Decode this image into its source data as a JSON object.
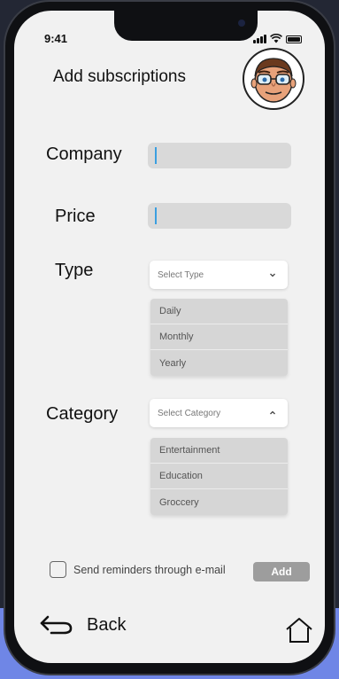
{
  "status_bar": {
    "time": "9:41"
  },
  "header": {
    "title": "Add subscriptions",
    "avatar_icon": "cartoon-face-avatar"
  },
  "form": {
    "company": {
      "label": "Company",
      "value": ""
    },
    "price": {
      "label": "Price",
      "value": ""
    },
    "type": {
      "label": "Type",
      "placeholder": "Select Type",
      "options": [
        "Daily",
        "Monthly",
        "Yearly"
      ]
    },
    "category": {
      "label": "Category",
      "placeholder": "Select Category",
      "options": [
        "Entertainment",
        "Education",
        "Groccery"
      ]
    },
    "reminder": {
      "label": "Send reminders through e-mail",
      "checked": false
    },
    "add_label": "Add"
  },
  "footer": {
    "back_label": "Back",
    "home_icon": "home-icon"
  },
  "colors": {
    "caret": "#3b9fe0",
    "add_button": "#9d9d9d",
    "screen_bg": "#f1f1f1"
  }
}
